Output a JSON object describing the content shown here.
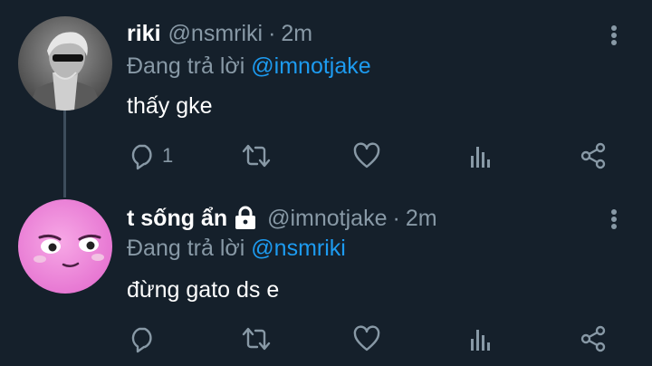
{
  "tweets": [
    {
      "display_name": "riki",
      "handle": "@nsmriki",
      "separator": "·",
      "time": "2m",
      "reply_prefix": "Đang trả lời",
      "reply_to": "@imnotjake",
      "text": "thấy gke",
      "reply_count": "1",
      "avatar_icon": "bw-photo-avatar",
      "protected": false
    },
    {
      "display_name": "t sống ẩn",
      "handle": "@imnotjake",
      "separator": "·",
      "time": "2m",
      "reply_prefix": "Đang trả lời",
      "reply_to": "@nsmriki",
      "text": "đừng gato ds e",
      "reply_count": "",
      "avatar_icon": "pink-face-avatar",
      "protected": true
    }
  ],
  "colors": {
    "background": "#15202b",
    "secondary_text": "#8899a6",
    "mention": "#1d9bf0",
    "thread_line": "#3d4d5c"
  }
}
